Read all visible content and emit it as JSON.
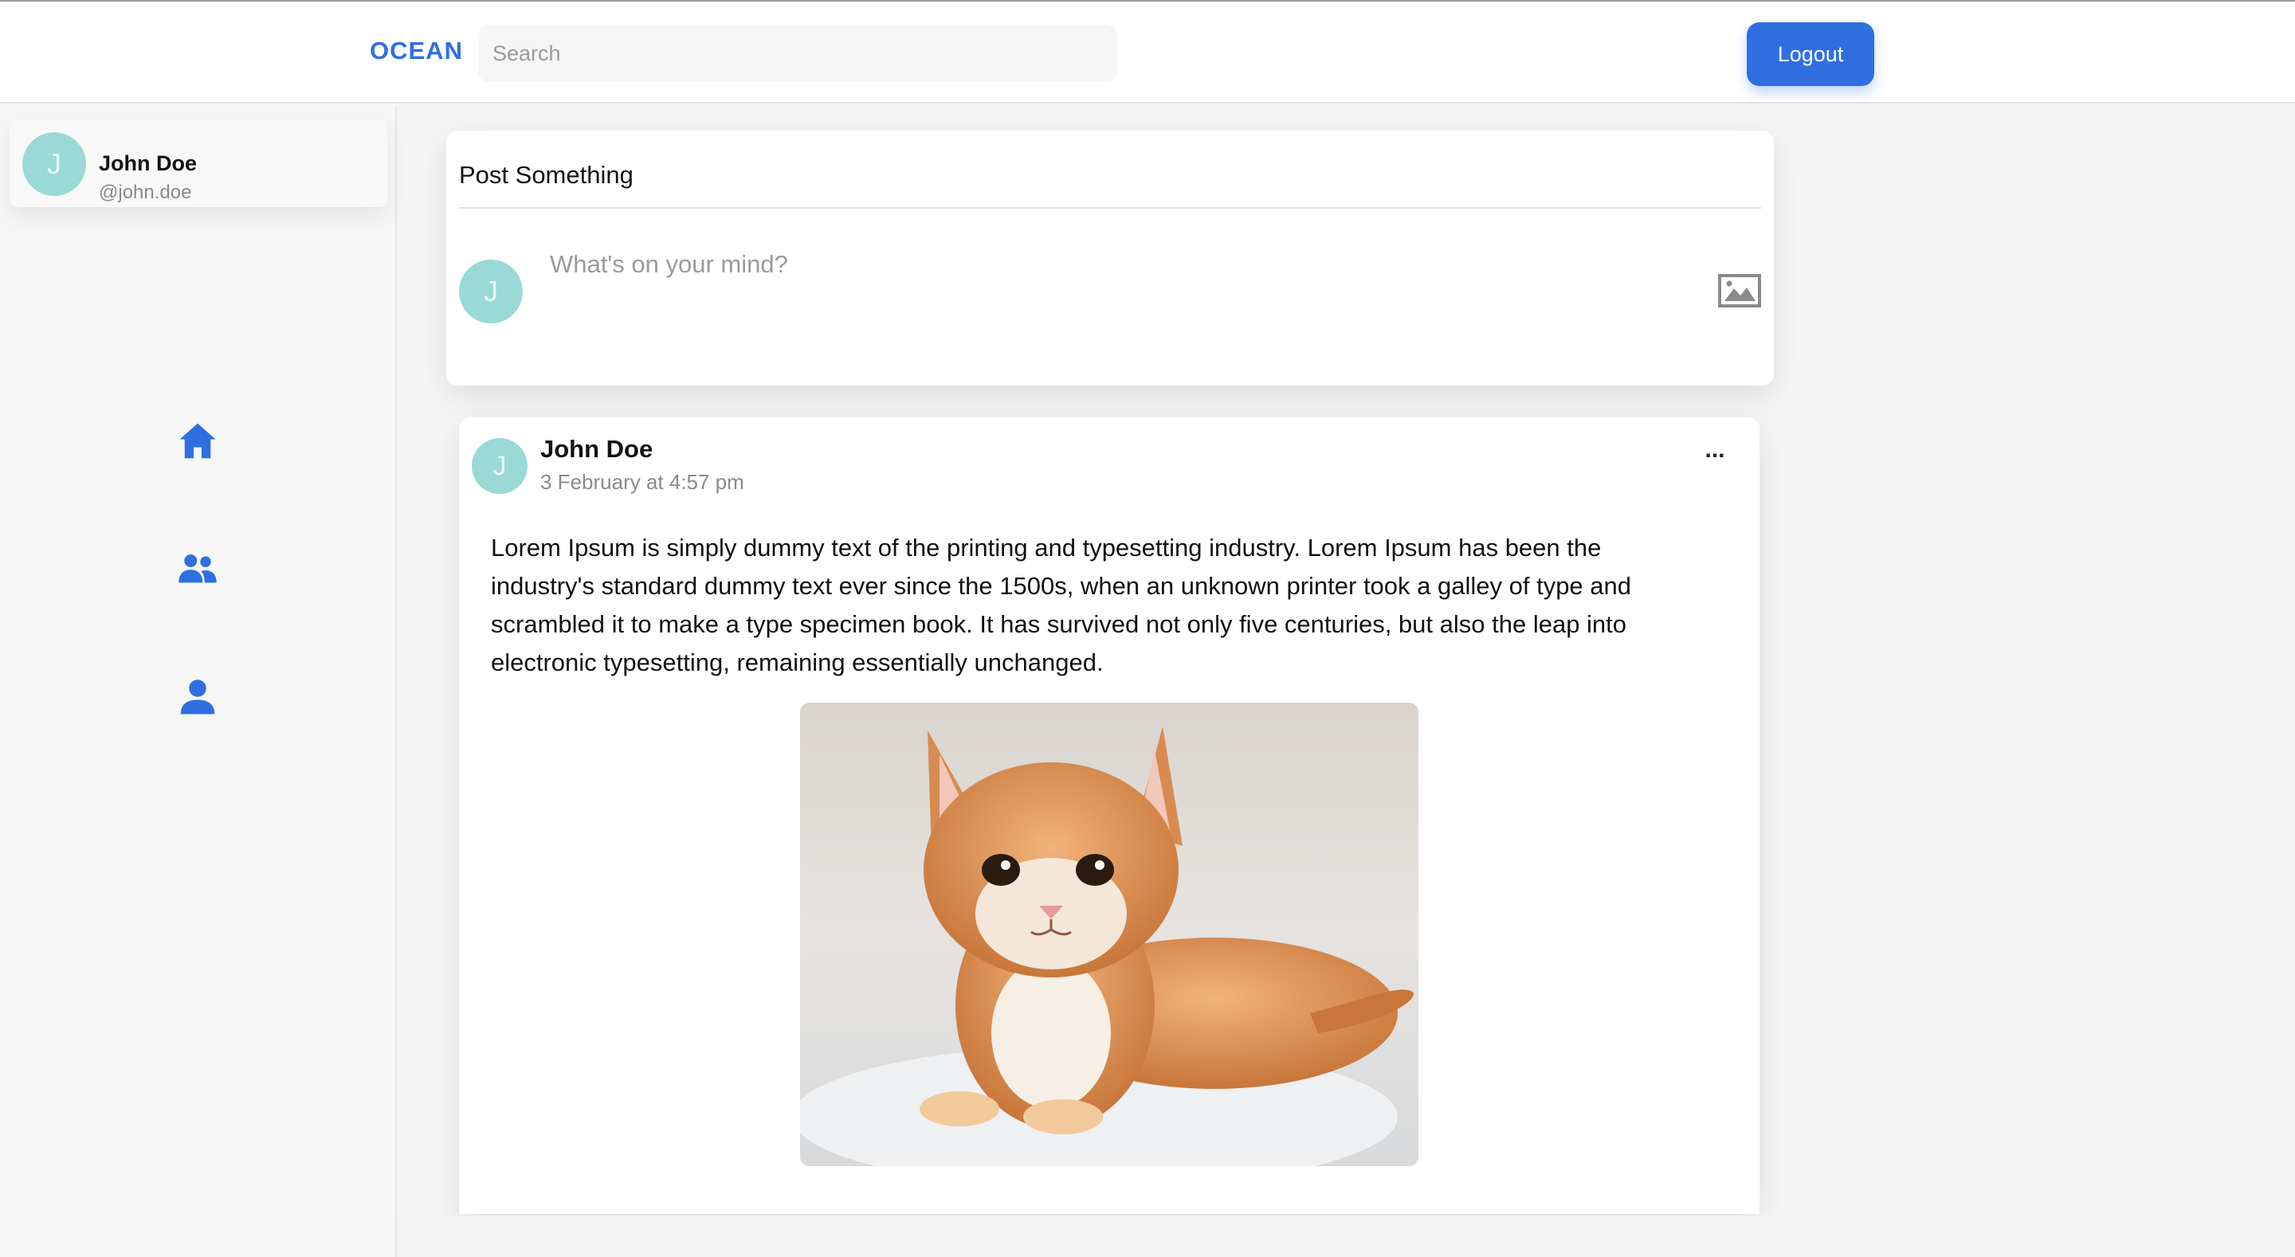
{
  "header": {
    "brand": "OCEAN",
    "search_placeholder": "Search",
    "logout_label": "Logout"
  },
  "user": {
    "name": "John Doe",
    "handle": "@john.doe",
    "initial": "J"
  },
  "sidebar": {
    "nav": [
      {
        "icon": "home-icon"
      },
      {
        "icon": "friends-icon"
      },
      {
        "icon": "profile-icon"
      }
    ]
  },
  "composer": {
    "title": "Post Something",
    "placeholder": "What's on your mind?",
    "initial": "J"
  },
  "post": {
    "author": "John Doe",
    "initial": "J",
    "timestamp": "3 February at 4:57 pm",
    "more_label": "...",
    "body": "Lorem Ipsum is simply dummy text of the printing and typesetting industry. Lorem Ipsum has been the industry's standard dummy text ever since the 1500s, when an unknown printer took a galley of type and scrambled it to make a type specimen book. It has survived not only five centuries, but also the leap into electronic typesetting, remaining essentially unchanged.",
    "image_icon": "cat-photo"
  },
  "colors": {
    "accent": "#2f6fe0",
    "avatar_bg": "#9ad9d6",
    "background": "#f5f5f5"
  }
}
